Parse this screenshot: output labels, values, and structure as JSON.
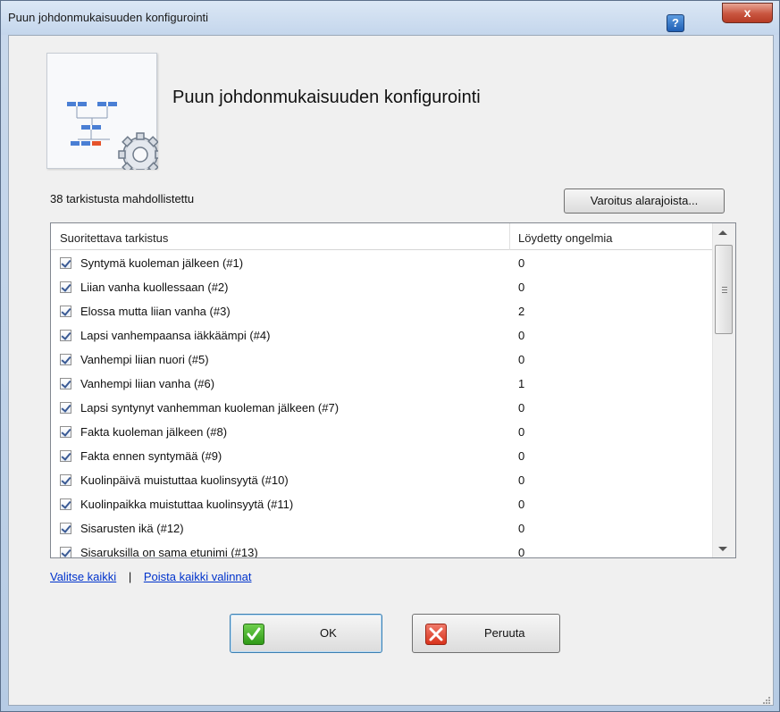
{
  "window": {
    "title": "Puun johdonmukaisuuden konfigurointi",
    "help_label": "?",
    "close_label": "x"
  },
  "header": {
    "heading": "Puun johdonmukaisuuden konfigurointi",
    "icon": "tree-settings-icon"
  },
  "summary": {
    "count_label": "38 tarkistusta mahdollistettu",
    "warning_button": "Varoitus alarajoista..."
  },
  "list": {
    "columns": [
      "Suoritettava tarkistus",
      "Löydetty ongelmia"
    ],
    "rows": [
      {
        "checked": true,
        "label": "Syntymä kuoleman jälkeen (#1)",
        "found": "0"
      },
      {
        "checked": true,
        "label": "Liian vanha kuollessaan (#2)",
        "found": "0"
      },
      {
        "checked": true,
        "label": "Elossa mutta liian vanha (#3)",
        "found": "2"
      },
      {
        "checked": true,
        "label": "Lapsi vanhempaansa iäkkäämpi (#4)",
        "found": "0"
      },
      {
        "checked": true,
        "label": "Vanhempi liian nuori (#5)",
        "found": "0"
      },
      {
        "checked": true,
        "label": "Vanhempi liian vanha (#6)",
        "found": "1"
      },
      {
        "checked": true,
        "label": "Lapsi syntynyt vanhemman kuoleman jälkeen (#7)",
        "found": "0"
      },
      {
        "checked": true,
        "label": "Fakta kuoleman jälkeen (#8)",
        "found": "0"
      },
      {
        "checked": true,
        "label": "Fakta ennen syntymää (#9)",
        "found": "0"
      },
      {
        "checked": true,
        "label": "Kuolinpäivä muistuttaa kuolinsyytä (#10)",
        "found": "0"
      },
      {
        "checked": true,
        "label": "Kuolinpaikka muistuttaa kuolinsyytä (#11)",
        "found": "0"
      },
      {
        "checked": true,
        "label": "Sisarusten ikä (#12)",
        "found": "0"
      },
      {
        "checked": true,
        "label": "Sisaruksilla on sama etunimi (#13)",
        "found": "0"
      }
    ]
  },
  "links": {
    "select_all": "Valitse kaikki",
    "separator": "|",
    "deselect_all": "Poista kaikki valinnat"
  },
  "buttons": {
    "ok": "OK",
    "cancel": "Peruuta"
  },
  "colors": {
    "accent": "#3a5a94",
    "link": "#0033cc",
    "ok_green": "#2f9a17",
    "cancel_red": "#d8321c"
  }
}
